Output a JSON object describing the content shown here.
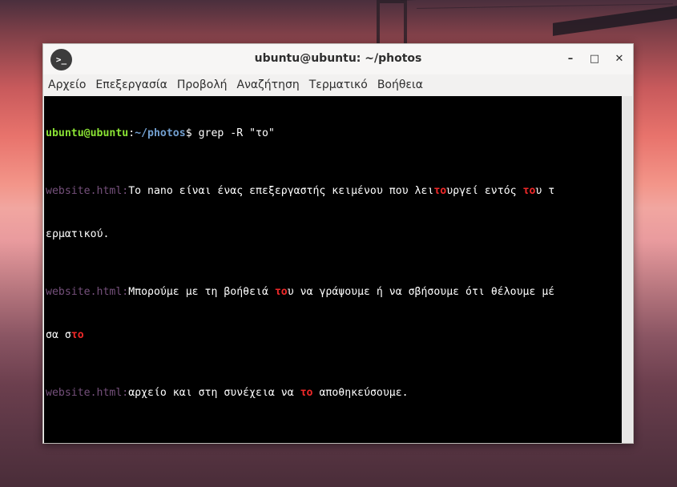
{
  "window": {
    "title": "ubuntu@ubuntu: ~/photos",
    "icon": "terminal-icon",
    "controls": {
      "minimize": "–",
      "maximize": "□",
      "close": "✕"
    }
  },
  "menu": [
    "Αρχείο",
    "Επεξεργασία",
    "Προβολή",
    "Αναζήτηση",
    "Τερματικό",
    "Βοήθεια"
  ],
  "terminal": {
    "prompt_user": "ubuntu@ubuntu",
    "prompt_sep": ":",
    "prompt_path": "~/photos",
    "prompt_symbol": "$ ",
    "command": "grep -R \"το\"",
    "file_prefix": "website.html",
    "colon": ":",
    "lines": [
      {
        "a": "Το nano είναι ένας επεξεργαστής κειμένου που λει",
        "m": "το",
        "b": "υργεί εντός "
      },
      {
        "a": "",
        "m": "το",
        "b": "υ τ"
      },
      {
        "a": "ερματικού.",
        "m": "",
        "b": ""
      },
      {
        "a": "Μπορούμε με τη βοήθειά ",
        "m": "το",
        "b": "υ να γράψουμε ή να σβήσουμε ότι θέλουμε μέ"
      },
      {
        "a": "σα σ",
        "m": "το",
        "b": ""
      },
      {
        "a": "αρχείο και στη συνέχεια να ",
        "m": "το",
        "b": " αποθηκεύσουμε."
      }
    ]
  }
}
